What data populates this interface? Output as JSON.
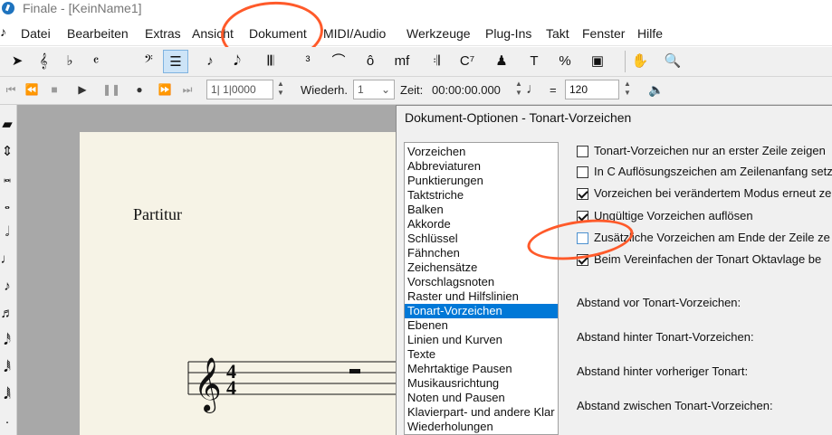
{
  "window": {
    "title": "Finale  - [KeinName1]"
  },
  "menu": {
    "items": [
      "Datei",
      "Bearbeiten",
      "Extras",
      "Ansicht",
      "Dokument",
      "MIDI/Audio",
      "Werkzeuge",
      "Plug-Ins",
      "Takt",
      "Fenster",
      "Hilfe"
    ]
  },
  "toolbar": {
    "tools": [
      {
        "name": "selection-tool-icon",
        "glyph": "➤"
      },
      {
        "name": "staff-tool-icon",
        "glyph": "𝄞"
      },
      {
        "name": "key-signature-tool-icon",
        "glyph": "♭"
      },
      {
        "name": "time-signature-tool-icon",
        "glyph": "𝄴"
      },
      {
        "name": "clef-tool-icon",
        "glyph": "𝄢"
      },
      {
        "name": "measure-tool-icon",
        "glyph": "☰"
      },
      {
        "name": "simple-entry-tool-icon",
        "glyph": "♪"
      },
      {
        "name": "speedy-entry-tool-icon",
        "glyph": "𝅘𝅥𝅮"
      },
      {
        "name": "hyper-scribe-tool-icon",
        "glyph": "𝄃𝄃"
      },
      {
        "name": "tuplet-tool-icon",
        "glyph": "³"
      },
      {
        "name": "smart-shape-tool-icon",
        "glyph": "⌒"
      },
      {
        "name": "articulation-tool-icon",
        "glyph": "ô"
      },
      {
        "name": "expression-tool-icon",
        "glyph": "mf"
      },
      {
        "name": "repeat-tool-icon",
        "glyph": "𝄇"
      },
      {
        "name": "chord-tool-icon",
        "glyph": "C⁷"
      },
      {
        "name": "lyrics-tool-icon",
        "glyph": "♟"
      },
      {
        "name": "text-tool-icon",
        "glyph": "T"
      },
      {
        "name": "graphics-tool-icon",
        "glyph": "%"
      },
      {
        "name": "page-layout-tool-icon",
        "glyph": "▣"
      },
      {
        "name": "hand-grabber-tool-icon",
        "glyph": "✋"
      },
      {
        "name": "zoom-tool-icon",
        "glyph": "🔍"
      }
    ]
  },
  "playback": {
    "counter": "1| 1|0000",
    "repeat_label": "Wiederh.",
    "repeat_value": "1",
    "time_label": "Zeit:",
    "time_value": "00:00:00.000",
    "tempo_equals": "=",
    "tempo_value": "120"
  },
  "document": {
    "title": "Partitur",
    "time_signature_top": "4",
    "time_signature_bottom": "4"
  },
  "dialog": {
    "title": "Dokument-Optionen - Tonart-Vorzeichen",
    "categories": [
      "Vorzeichen",
      "Abbreviaturen",
      "Punktierungen",
      "Taktstriche",
      "Balken",
      "Akkorde",
      "Schlüssel",
      "Fähnchen",
      "Zeichensätze",
      "Vorschlagsnoten",
      "Raster und Hilfslinien",
      "Tonart-Vorzeichen",
      "Ebenen",
      "Linien und Kurven",
      "Texte",
      "Mehrtaktige Pausen",
      "Musikausrichtung",
      "Noten und Pausen",
      "Klavierpart- und andere Klar",
      "Wiederholungen"
    ],
    "selected_category": "Tonart-Vorzeichen",
    "options": [
      {
        "label": "Tonart-Vorzeichen nur an erster Zeile zeigen",
        "checked": false
      },
      {
        "label": "In C Auflösungszeichen am Zeilenanfang setz",
        "checked": false
      },
      {
        "label": "Vorzeichen bei verändertem Modus erneut ze",
        "checked": true
      },
      {
        "label": "Ungültige Vorzeichen auflösen",
        "checked": true
      },
      {
        "label": "Zusätzliche Vorzeichen am Ende der Zeile ze",
        "checked": false
      },
      {
        "label": "Beim Vereinfachen der Tonart Oktavlage be",
        "checked": true
      }
    ],
    "distance_labels": [
      "Abstand vor Tonart-Vorzeichen:",
      "Abstand hinter Tonart-Vorzeichen:",
      "Abstand hinter vorheriger Tonart:",
      "Abstand zwischen Tonart-Vorzeichen:"
    ]
  },
  "colors": {
    "accent": "#0078d7",
    "annotation": "#ff5a2a",
    "paper": "#f6f3e6"
  }
}
